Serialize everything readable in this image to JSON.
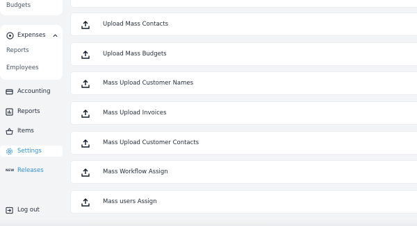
{
  "sidebar": {
    "budgets_label": "Budgets",
    "expenses": {
      "label": "Expenses",
      "icon": "circle-dollar-icon",
      "children": [
        "Reports",
        "Employees"
      ]
    },
    "items": [
      {
        "label": "Accounting",
        "icon": "credit-card-icon"
      },
      {
        "label": "Reports",
        "icon": "bar-chart-icon"
      },
      {
        "label": "Items",
        "icon": "basket-icon"
      },
      {
        "label": "Settings",
        "icon": "gear-icon",
        "active": true
      },
      {
        "label": "Releases",
        "icon": "new-badge-icon",
        "badge": "NEW"
      },
      {
        "label": "Log out",
        "icon": "logout-icon"
      }
    ],
    "accent_color": "#2f8fd6"
  },
  "uploads": [
    "Upload Mass Contacts",
    "Upload Mass Budgets",
    "Mass Upload Customer Names",
    "Mass Upload Invoices",
    "Mass Upload Customer Contacts",
    "Mass Workflow Assign",
    "Mass users Assign"
  ]
}
